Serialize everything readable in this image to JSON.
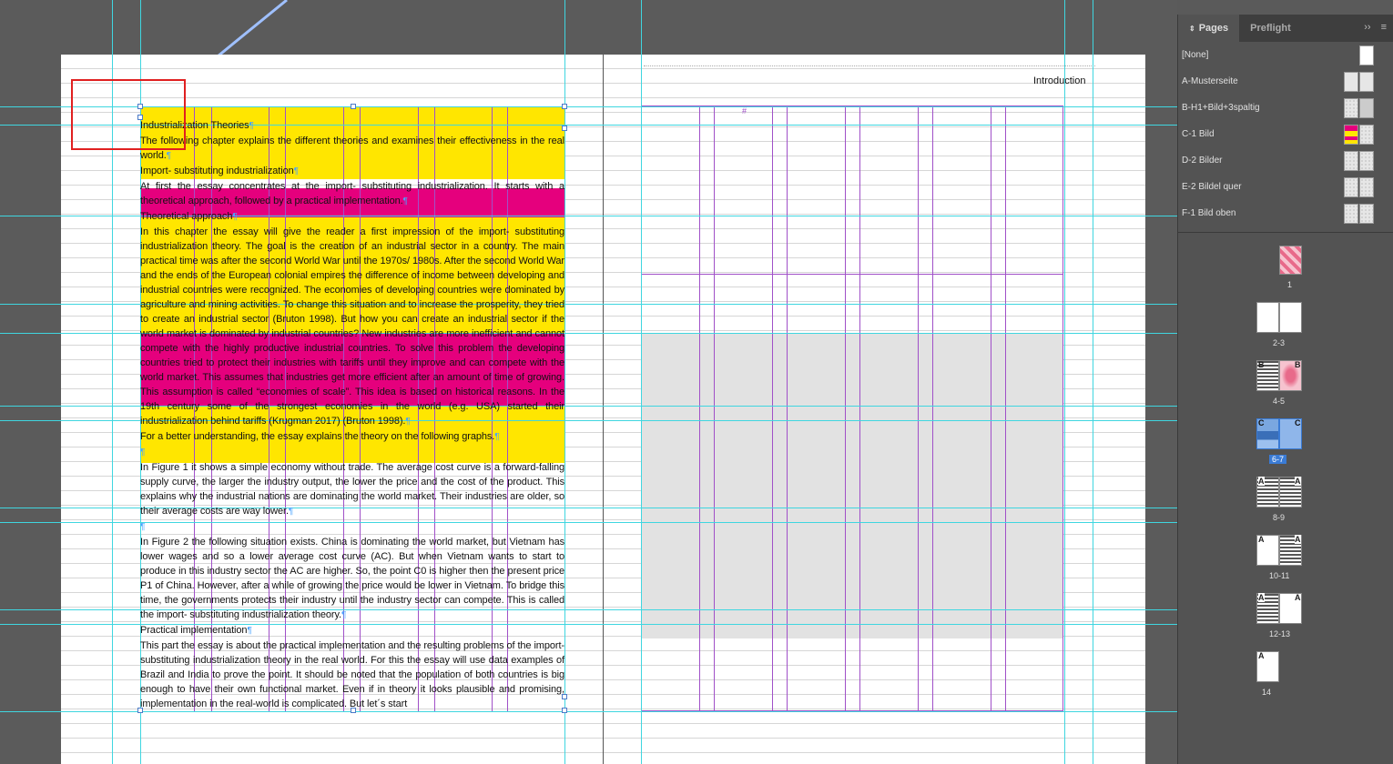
{
  "document": {
    "running_header": "Introduction",
    "paragraphs": [
      {
        "text": "Industrialization Theories"
      },
      {
        "text": "The following chapter explains the different theories and examines their effectiveness in the real world."
      },
      {
        "text": "Import- substituting industrialization"
      },
      {
        "text": "At first the essay concentrates at the import- substituting industrialization. It starts with a theoretical approach, followed by a practical implementation."
      },
      {
        "text": "Theoretical approach"
      },
      {
        "text": "In this chapter the essay will give the reader a first impression of the import- substituting industrialization theory. The goal is the creation of an industrial sector in a country. The main practical time was after the second World War until the 1970s/ 1980s. After the second World War and the ends of the European colonial empires the difference of income between developing and industrial countries were recognized. The economies of developing countries were dominated by agriculture and mining activities. To change this situation and to increase the prosperity, they tried to create an industrial sector (Bruton 1998). But how you can create an industrial sector if the world market is dominated by industrial countries? New industries are more inefficient and cannot compete with the highly productive industrial countries. To solve this problem the developing countries tried to protect their industries with tariffs until they improve and can compete with the world market. This assumes that industries get more efficient after an amount of time of growing. This assumption is called “economies of scale”. This idea is based on historical reasons. In the 19th century some of the strongest economies in the world (e.g. USA) started their industrialization behind tariffs (Krugman 2017) (Bruton 1998)."
      },
      {
        "text": "For a better understanding, the essay explains the theory on the following graphs."
      },
      {
        "text": ""
      },
      {
        "text": "In Figure 1 it shows a simple economy without trade. The average cost curve is a forward-falling supply curve, the larger the industry output, the lower the price and the cost of the product. This explains why the industrial nations are dominating the world market. Their industries are older, so their average costs are way lower."
      },
      {
        "text": ""
      },
      {
        "text": "In Figure 2 the following situation exists. China is dominating the world market, but Vietnam has lower wages and so a lower average cost curve (AC). But when Vietnam wants to start to produce in this industry sector the AC are higher. So, the point C0 is higher then the present price P1 of China. However, after a while of growing the price would be lower in Vietnam. To bridge this time, the governments protects their industry until the industry sector can compete. This is called the import- substituting industrialization theory."
      },
      {
        "text": "Practical implementation"
      },
      {
        "text": "This part the essay is about the practical implementation and the resulting problems of the import- substituting industrialization theory in the real world. For this the essay will use data examples of Brazil and India to prove the point. It should be noted that the population of both countries is big enough to have their own functional market. Even if in theory it looks plausible and promising, implementation in the real-world is complicated. But let´s start"
      }
    ],
    "pilcrow": "¶",
    "frame_marker": "#"
  },
  "pages_panel": {
    "tabs": [
      {
        "label": "Pages",
        "icon": "up-down-arrows-icon"
      },
      {
        "label": "Preflight"
      }
    ],
    "menu_icon": "panel-menu-icon",
    "collapse_icon": "double-chevron-icon",
    "masters": [
      {
        "label": "[None]"
      },
      {
        "label": "A-Musterseite"
      },
      {
        "label": "B-H1+Bild+3spaltig"
      },
      {
        "label": "C-1 Bild"
      },
      {
        "label": "D-2 Bilder"
      },
      {
        "label": "E-2 Bildel quer"
      },
      {
        "label": "F-1 Bild oben"
      }
    ],
    "spreads": [
      {
        "label": "1",
        "selected": false
      },
      {
        "label": "2-3",
        "selected": false
      },
      {
        "label": "4-5",
        "selected": false,
        "left_master": "B",
        "right_master": "B"
      },
      {
        "label": "6-7",
        "selected": true,
        "left_master": "C",
        "right_master": "C"
      },
      {
        "label": "8-9",
        "selected": false,
        "left_master": "A",
        "right_master": "A"
      },
      {
        "label": "10-11",
        "selected": false,
        "left_master": "A",
        "right_master": "A"
      },
      {
        "label": "12-13",
        "selected": false,
        "left_master": "A",
        "right_master": "A"
      },
      {
        "label": "14",
        "selected": false,
        "left_master": "A"
      }
    ]
  },
  "colors": {
    "highlight_yellow": "#ffe600",
    "highlight_magenta": "#e5007d",
    "guide_cyan": "#3fd6e0",
    "frame_purple": "#a050c8",
    "selection_blue": "#3a7bd5",
    "annotation_red": "#e02020"
  }
}
